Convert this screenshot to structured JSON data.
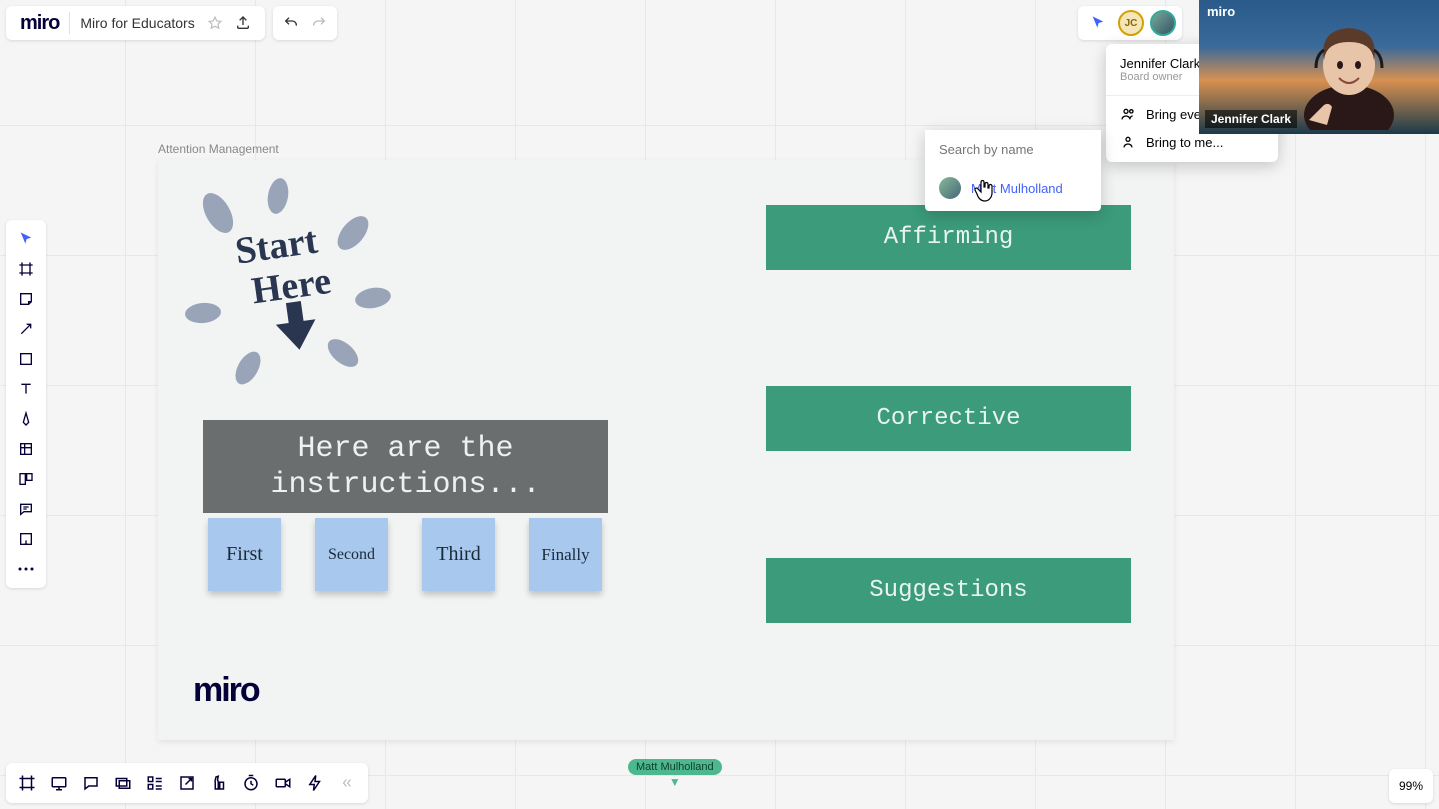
{
  "header": {
    "logo": "miro",
    "board_title": "Miro for Educators"
  },
  "frame": {
    "label": "Attention Management",
    "instructions": "Here are the instructions...",
    "stickies": [
      "First",
      "Second",
      "Third",
      "Finally"
    ],
    "blocks": [
      "Affirming",
      "Corrective",
      "Suggestions"
    ],
    "bottom_logo": "miro",
    "start_here_text1": "Start",
    "start_here_text2": "Here"
  },
  "user_menu": {
    "name": "Jennifer Clark (yo",
    "role": "Board owner",
    "items": [
      "Bring everyo",
      "Bring to me..."
    ]
  },
  "search": {
    "placeholder": "Search by name",
    "result": "Matt Mulholland"
  },
  "avatars": {
    "jc_initials": "JC"
  },
  "video": {
    "logo": "miro",
    "name": "Jennifer Clark"
  },
  "collab_cursor": "Matt Mulholland",
  "zoom": "99%"
}
